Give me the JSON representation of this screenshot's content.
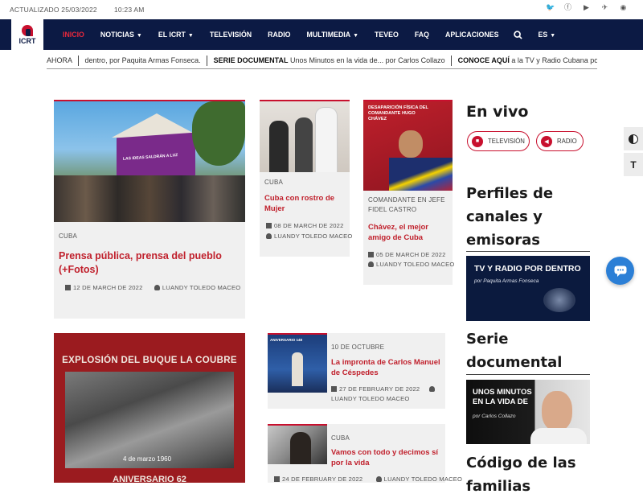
{
  "topbar": {
    "updated": "ACTUALIZADO 25/03/2022",
    "time": "10:23 AM"
  },
  "social": [
    "twitter-icon",
    "facebook-icon",
    "youtube-icon",
    "telegram-icon",
    "rss-icon"
  ],
  "logo": {
    "text": "ICRT"
  },
  "menu": [
    {
      "label": "INICIO",
      "dropdown": false,
      "active": true
    },
    {
      "label": "NOTICIAS",
      "dropdown": true
    },
    {
      "label": "EL ICRT",
      "dropdown": true
    },
    {
      "label": "TELEVISIÓN",
      "dropdown": false
    },
    {
      "label": "RADIO",
      "dropdown": false
    },
    {
      "label": "MULTIMEDIA",
      "dropdown": true
    },
    {
      "label": "TEVEO",
      "dropdown": false
    },
    {
      "label": "FAQ",
      "dropdown": false
    },
    {
      "label": "APLICACIONES",
      "dropdown": false
    }
  ],
  "lang": "ES",
  "ticker": {
    "label": "AHORA",
    "item1": "dentro, por Paquita Armas Fonseca.",
    "item2_bold": "SERIE DOCUMENTAL",
    "item2": "Unos Minutos en la vida de... por Carlos Collazo",
    "item3_bold": "CONOCE AQUÍ",
    "item3": "a la TV y Radio Cubana por dentro, p"
  },
  "cards": {
    "main": {
      "image_text": "LAS IDEAS SALDRÁN A LUZ",
      "category": "CUBA",
      "title": "Prensa pública, prensa del pueblo (+Fotos)",
      "date": "12 DE MARCH DE 2022",
      "author": "LUANDY TOLEDO MACEO"
    },
    "mujer": {
      "category": "CUBA",
      "title": "Cuba con rostro de Mujer",
      "date": "08 DE MARCH DE 2022",
      "author": "LUANDY TOLEDO MACEO"
    },
    "chavez": {
      "image_title": "DESAPARICIÓN FÍSICA DEL COMANDANTE HUGO CHÁVEZ",
      "category": "COMANDANTE EN JEFE FIDEL CASTRO",
      "title": "Chávez, el mejor amigo de Cuba",
      "date": "05 DE MARCH DE 2022",
      "author": "LUANDY TOLEDO MACEO"
    },
    "coubre": {
      "image_title": "EXPLOSIÓN DEL BUQUE LA COUBRE",
      "image_date": "4 de marzo 1960",
      "image_bottom": "ANIVERSARIO 62"
    },
    "cespedes": {
      "image_text": "ANIVERSARIO 148",
      "category": "10 DE OCTUBRE",
      "title": "La impronta de Carlos Manuel de Céspedes",
      "date": "27 DE FEBRUARY DE 2022",
      "author": "LUANDY TOLEDO MACEO"
    },
    "vamos": {
      "category": "CUBA",
      "title": "Vamos con todo y decimos sí por la vida",
      "date": "24 DE FEBRUARY DE 2022",
      "author": "LUANDY TOLEDO MACEO"
    }
  },
  "sidebar": {
    "envivo": "En vivo",
    "tv": "TELEVISIÓN",
    "radio": "RADIO",
    "perfiles": "Perfiles de canales y emisoras",
    "banner1_title": "TV Y RADIO POR DENTRO",
    "banner1_sub": "por Paquita Armas Fonseca",
    "serie": "Serie documental",
    "banner2_title": "UNOS MINUTOS EN LA VIDA DE",
    "banner2_sub": "por Carlos Collazo",
    "codigo": "Código de las familias"
  },
  "colors": {
    "navy": "#0c1a44",
    "red": "#c8102e",
    "title_red": "#c0202c"
  }
}
